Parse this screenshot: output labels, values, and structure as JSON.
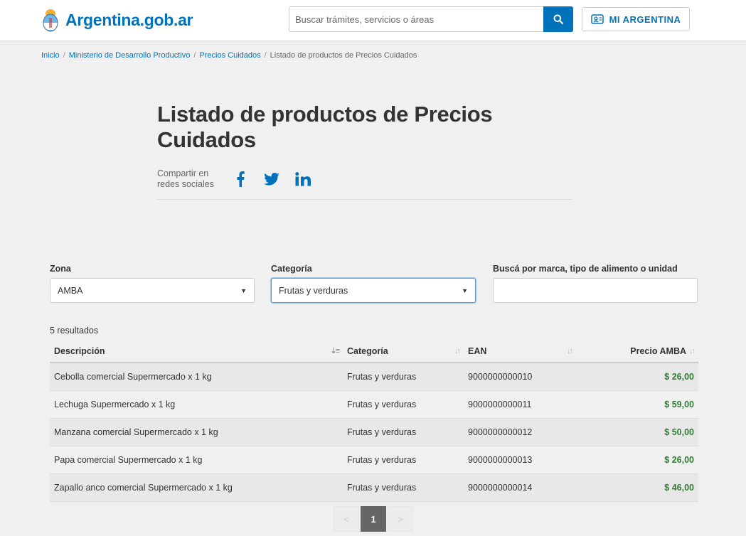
{
  "header": {
    "logo_text": "Argentina.gob.ar",
    "search_placeholder": "Buscar trámites, servicios o áreas",
    "mi_argentina_label": "MI ARGENTINA"
  },
  "breadcrumb": {
    "items": [
      "Inicio",
      "Ministerio de Desarrollo Productivo",
      "Precios Cuidados"
    ],
    "current": "Listado de productos de Precios Cuidados"
  },
  "page": {
    "title": "Listado de productos de Precios Cuidados",
    "share_label_1": "Compartir en",
    "share_label_2": "redes sociales"
  },
  "filters": {
    "zona_label": "Zona",
    "zona_value": "AMBA",
    "categoria_label": "Categoría",
    "categoria_value": "Frutas y verduras",
    "search_label": "Buscá por marca, tipo de alimento o unidad",
    "search_value": ""
  },
  "results_count": "5 resultados",
  "table": {
    "headers": {
      "descripcion": "Descripción",
      "categoria": "Categoría",
      "ean": "EAN",
      "precio": "Precio AMBA"
    },
    "rows": [
      {
        "descripcion": "Cebolla comercial Supermercado x 1 kg",
        "categoria": "Frutas y verduras",
        "ean": "9000000000010",
        "precio": "$ 26,00"
      },
      {
        "descripcion": "Lechuga Supermercado x 1 kg",
        "categoria": "Frutas y verduras",
        "ean": "9000000000011",
        "precio": "$ 59,00"
      },
      {
        "descripcion": "Manzana comercial Supermercado x 1 kg",
        "categoria": "Frutas y verduras",
        "ean": "9000000000012",
        "precio": "$ 50,00"
      },
      {
        "descripcion": "Papa comercial Supermercado x 1 kg",
        "categoria": "Frutas y verduras",
        "ean": "9000000000013",
        "precio": "$ 26,00"
      },
      {
        "descripcion": "Zapallo anco comercial Supermercado x 1 kg",
        "categoria": "Frutas y verduras",
        "ean": "9000000000014",
        "precio": "$ 46,00"
      }
    ]
  },
  "pagination": {
    "prev": "<",
    "current": "1",
    "next": ">"
  },
  "colors": {
    "brand_blue": "#0072bb",
    "price_green": "#2e7d32"
  }
}
